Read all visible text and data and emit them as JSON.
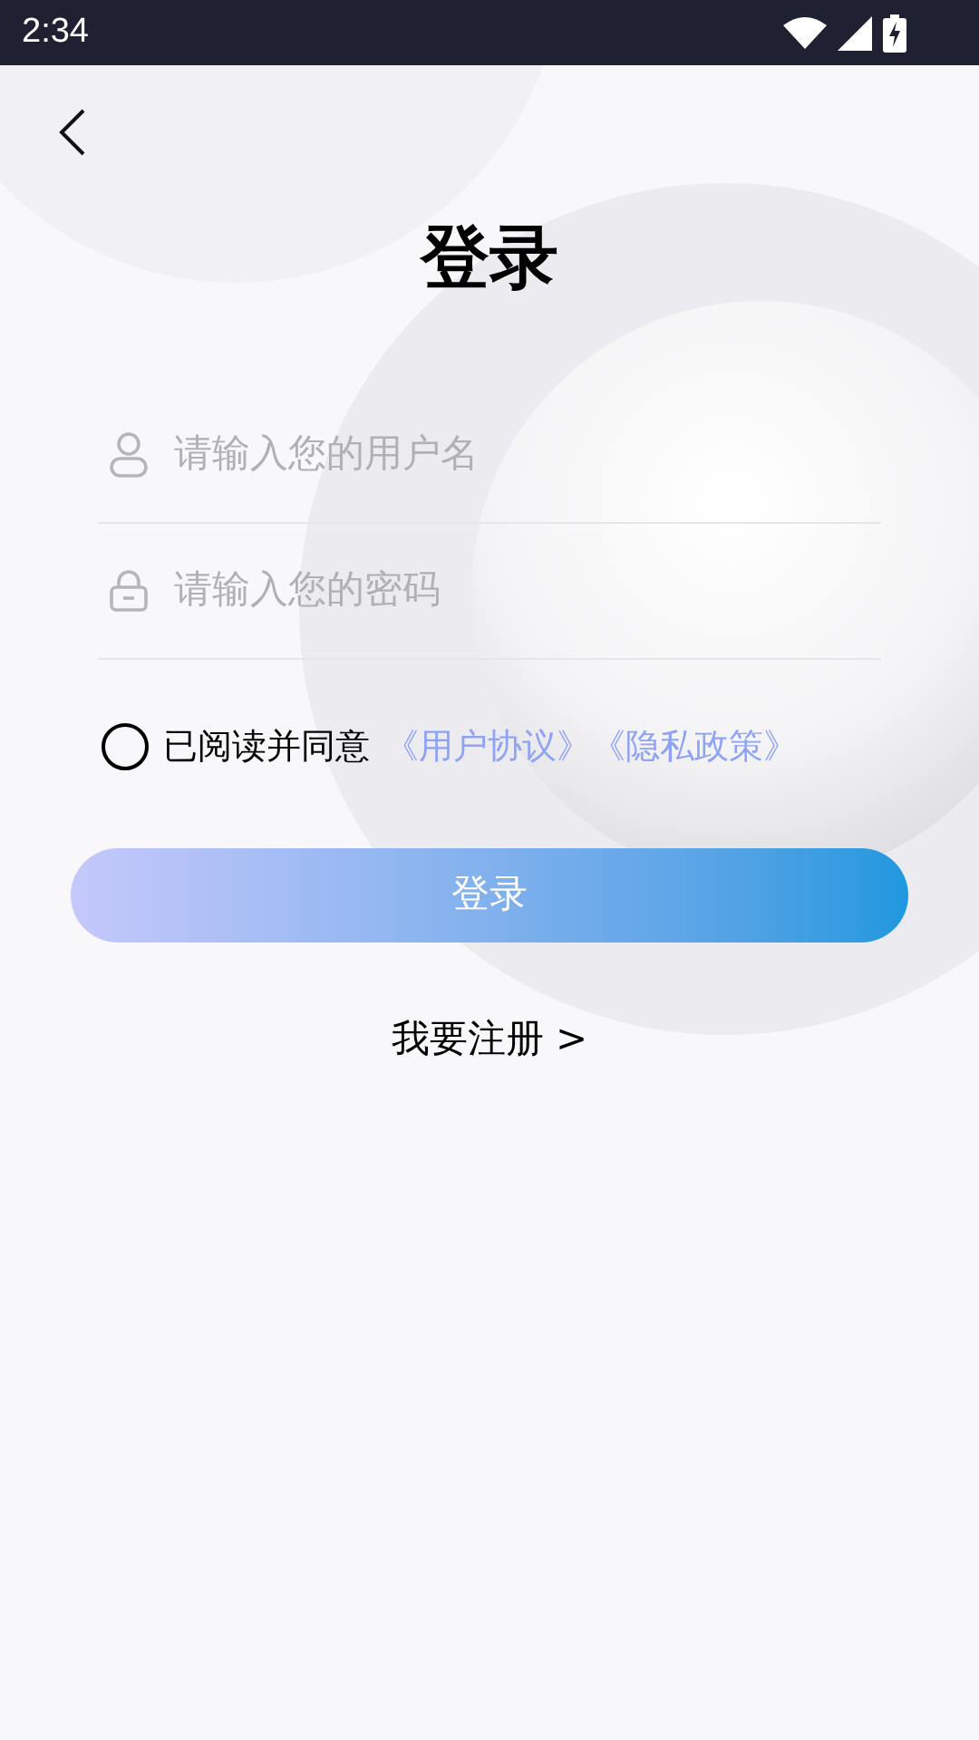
{
  "status_bar": {
    "time": "2:34"
  },
  "title": "登录",
  "fields": [
    {
      "kind": "user",
      "placeholder": "请输入您的用户名"
    },
    {
      "kind": "lock",
      "placeholder": "请输入您的密码"
    }
  ],
  "agreement": {
    "checked": false,
    "text": "已阅读并同意",
    "links": [
      "《用户协议》",
      "《隐私政策》"
    ]
  },
  "login_button": "登录",
  "register_link": "我要注册 >"
}
